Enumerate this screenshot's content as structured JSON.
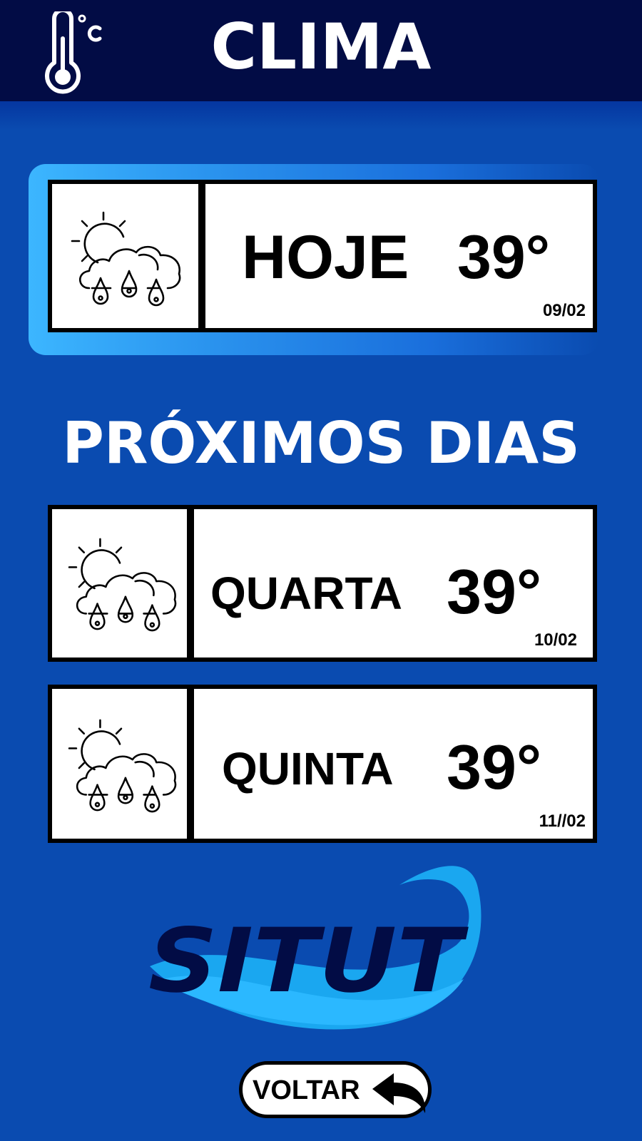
{
  "header": {
    "title": "CLIMA",
    "icon": "thermometer-celsius-icon"
  },
  "today": {
    "day": "HOJE",
    "temp": "39°",
    "date": "09/02",
    "icon": "sun-cloud-rain-icon"
  },
  "section": {
    "title": "PRÓXIMOS DIAS"
  },
  "forecast": [
    {
      "day": "QUARTA",
      "temp": "39°",
      "date": "10/02",
      "icon": "sun-cloud-rain-icon"
    },
    {
      "day": "QUINTA",
      "temp": "39°",
      "date": "11//02",
      "icon": "sun-cloud-rain-icon"
    }
  ],
  "logo": {
    "text": "SITUT"
  },
  "back_button": {
    "label": "VOLTAR",
    "icon": "undo-arrow-icon"
  },
  "colors": {
    "background": "#0a4bb0",
    "header": "#020c45",
    "glow": "#3cb6ff",
    "logo_text": "#020c45",
    "logo_wave": "#1aa7f0"
  }
}
